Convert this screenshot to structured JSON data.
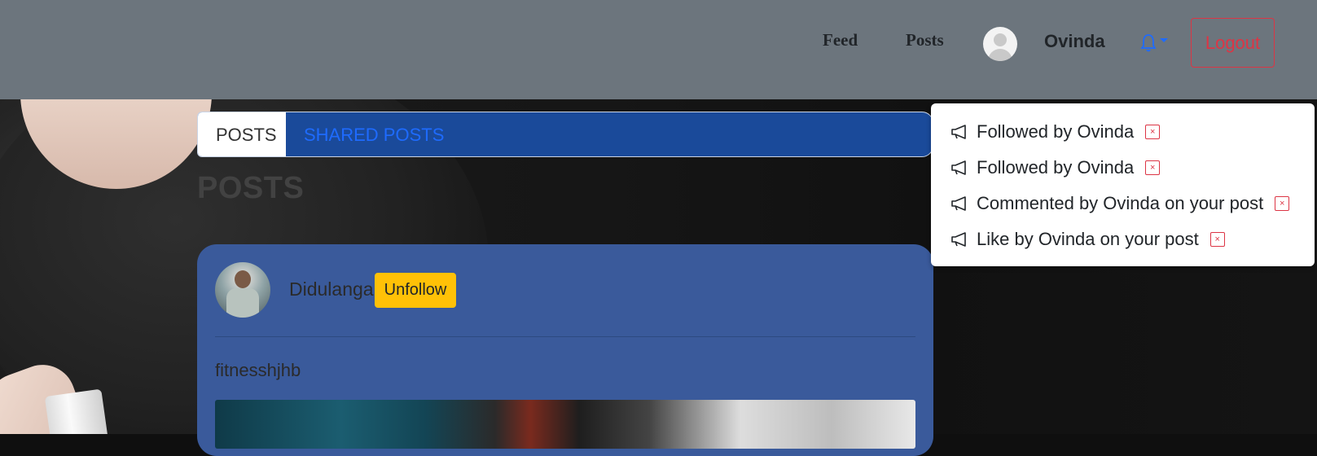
{
  "navbar": {
    "links": [
      "Feed",
      "Posts"
    ],
    "username": "Ovinda",
    "logout_label": "Logout"
  },
  "tabs": [
    {
      "label": "POSTS",
      "active": true
    },
    {
      "label": "SHARED POSTS",
      "active": false
    }
  ],
  "page_heading": "POSTS",
  "post": {
    "author": "Didulanga",
    "follow_button": "Unfollow",
    "text": "fitnesshjhb"
  },
  "notifications": [
    {
      "text": "Followed by Ovinda",
      "dismiss": "×"
    },
    {
      "text": "Followed by Ovinda",
      "dismiss": "×"
    },
    {
      "text": "Commented by Ovinda on your post",
      "dismiss": "×"
    },
    {
      "text": "Like by Ovinda on your post",
      "dismiss": "×"
    }
  ],
  "colors": {
    "navbar_bg": "#6c757d",
    "tabs_bg": "#1a4a9a",
    "card_bg": "#3a5a9b",
    "warning": "#ffc107",
    "danger": "#dc3545",
    "link_blue": "#1e6bff"
  }
}
